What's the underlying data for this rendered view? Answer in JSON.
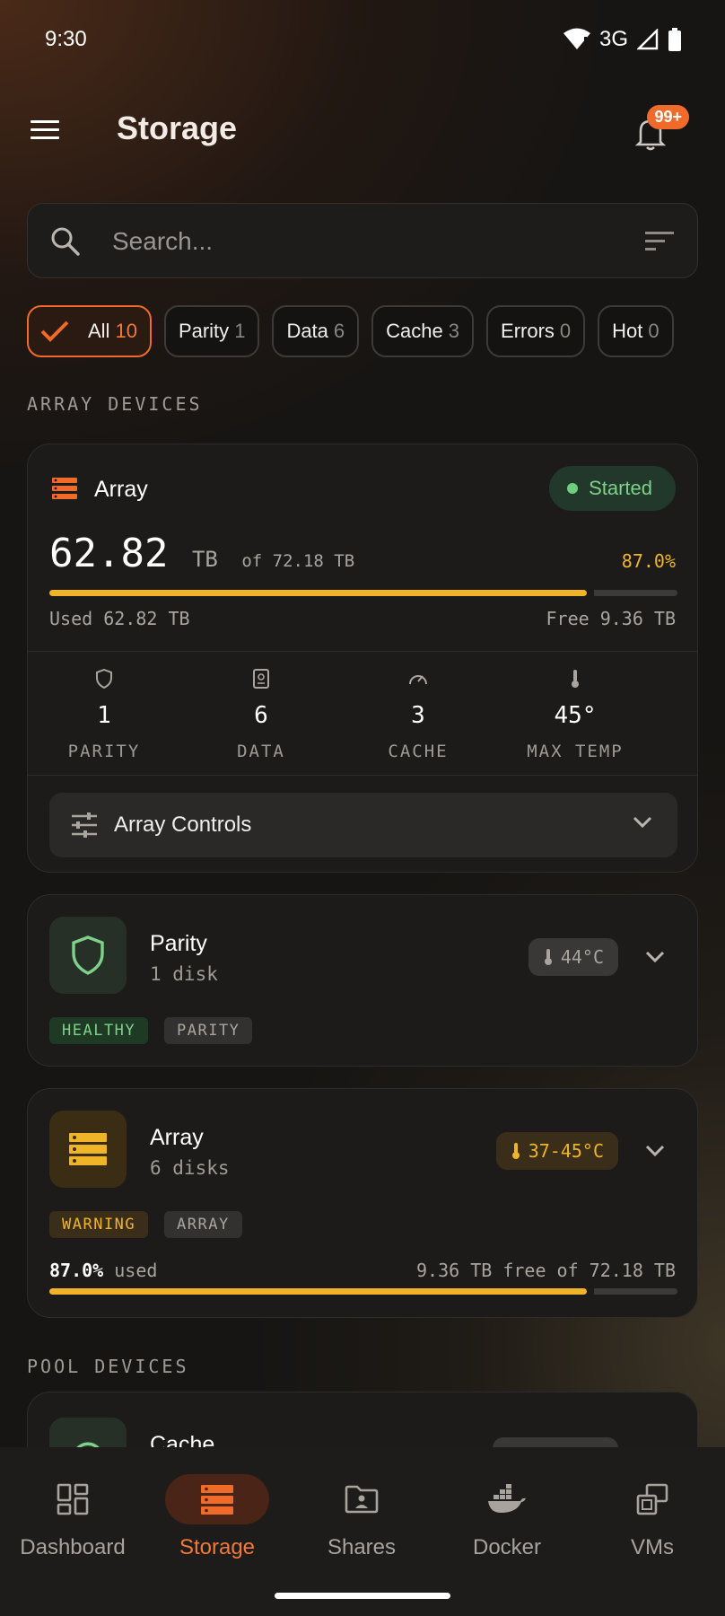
{
  "status_bar": {
    "time": "9:30",
    "network": "3G"
  },
  "app_bar": {
    "title": "Storage",
    "notification_badge": "99+"
  },
  "search": {
    "placeholder": "Search...",
    "value": ""
  },
  "filters": [
    {
      "label": "All",
      "count": "10",
      "selected": true
    },
    {
      "label": "Parity",
      "count": "1"
    },
    {
      "label": "Data",
      "count": "6"
    },
    {
      "label": "Cache",
      "count": "3"
    },
    {
      "label": "Errors",
      "count": "0"
    },
    {
      "label": "Hot",
      "count": "0"
    }
  ],
  "sections": {
    "array": "ARRAY DEVICES",
    "pool": "POOL DEVICES"
  },
  "array_summary": {
    "title": "Array",
    "status": "Started",
    "used_value": "62.82",
    "used_unit": "TB",
    "total_text": "of 72.18 TB",
    "percent": "87.0%",
    "used_fraction": 0.87,
    "used_label": "Used 62.82 TB",
    "free_label": "Free 9.36 TB",
    "stats": [
      {
        "value": "1",
        "label": "PARITY",
        "icon": "shield-icon"
      },
      {
        "value": "6",
        "label": "DATA",
        "icon": "drive-icon"
      },
      {
        "value": "3",
        "label": "CACHE",
        "icon": "speedometer-icon"
      },
      {
        "value": "45°",
        "label": "MAX TEMP",
        "icon": "thermometer-icon"
      }
    ],
    "controls_label": "Array Controls"
  },
  "devices": [
    {
      "title": "Parity",
      "subtitle": "1 disk",
      "temp": "44°C",
      "tags": [
        "HEALTHY",
        "PARITY"
      ]
    },
    {
      "title": "Array",
      "subtitle": "6 disks",
      "temp": "37-45°C",
      "tags": [
        "WARNING",
        "ARRAY"
      ],
      "usage_percent": "87.0%",
      "usage_word": "used",
      "usage_detail": "9.36 TB free of 72.18 TB",
      "used_fraction": 0.87
    },
    {
      "title": "Cache"
    }
  ],
  "bottom_nav": [
    {
      "label": "Dashboard",
      "icon": "dashboard-icon"
    },
    {
      "label": "Storage",
      "icon": "storage-icon",
      "active": true
    },
    {
      "label": "Shares",
      "icon": "shares-folder-icon"
    },
    {
      "label": "Docker",
      "icon": "docker-icon"
    },
    {
      "label": "VMs",
      "icon": "vms-icon"
    }
  ],
  "colors": {
    "accent": "#f06a2a",
    "warning": "#f0b429",
    "healthy": "#7ed08a"
  }
}
